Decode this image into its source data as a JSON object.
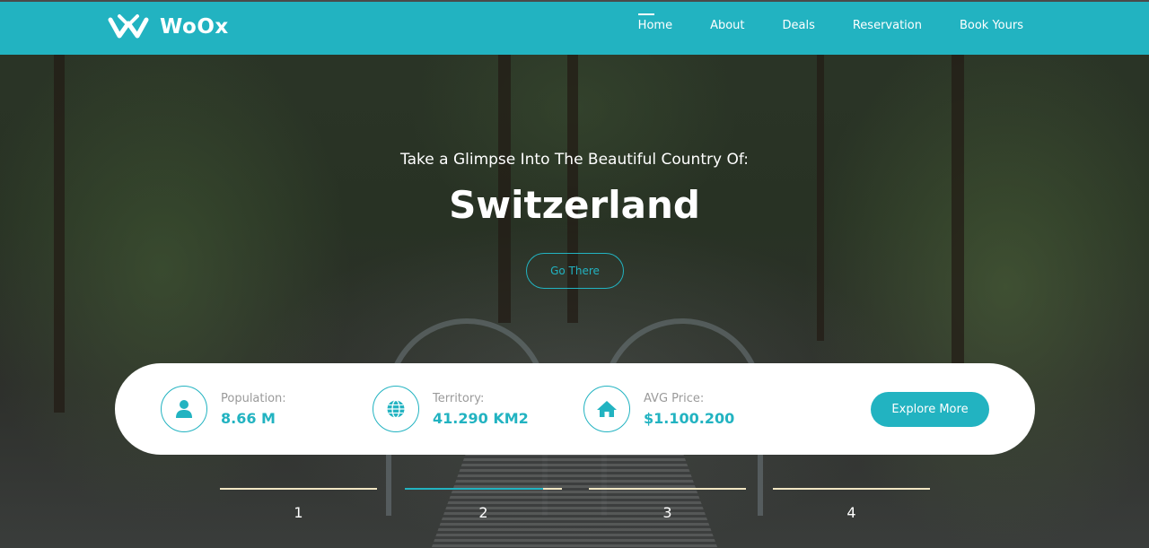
{
  "brand": {
    "name": "WoOx",
    "icon": "woox-logo-icon"
  },
  "nav": {
    "items": [
      {
        "label": "Home",
        "active": true
      },
      {
        "label": "About",
        "active": false
      },
      {
        "label": "Deals",
        "active": false
      },
      {
        "label": "Reservation",
        "active": false
      },
      {
        "label": "Book Yours",
        "active": false
      }
    ]
  },
  "hero": {
    "subtitle": "Take a Glimpse Into The Beautiful Country Of:",
    "title": "Switzerland",
    "button_label": "Go There"
  },
  "info": {
    "stats": [
      {
        "label": "Population:",
        "value": "8.66 M",
        "icon": "user-icon"
      },
      {
        "label": "Territory:",
        "value": "41.290 KM2",
        "icon": "globe-icon"
      },
      {
        "label": "AVG Price:",
        "value": "$1.100.200",
        "icon": "home-icon"
      }
    ],
    "button_label": "Explore More"
  },
  "slider": {
    "tabs": [
      {
        "label": "1",
        "progress": 0
      },
      {
        "label": "2",
        "progress": 0.88
      },
      {
        "label": "3",
        "progress": 0
      },
      {
        "label": "4",
        "progress": 0
      }
    ]
  },
  "colors": {
    "accent": "#22b3c1",
    "text_light": "#ffffff",
    "muted": "#9a9a9a",
    "tab_line": "#f1e6c3"
  }
}
